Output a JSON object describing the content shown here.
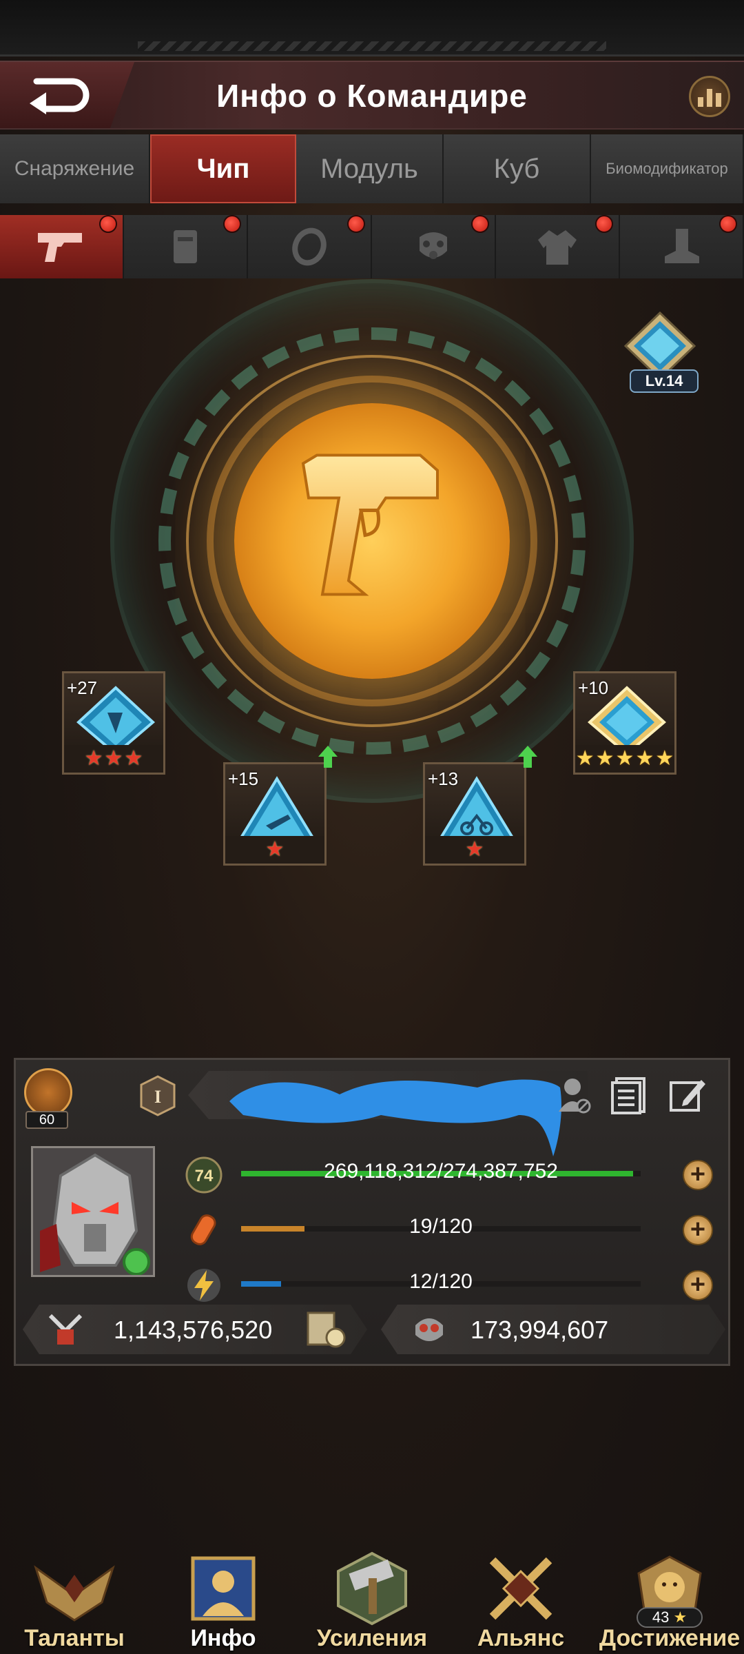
{
  "header": {
    "title": "Инфо о Командире"
  },
  "tabs": [
    {
      "label": "Снаряжение"
    },
    {
      "label": "Чип"
    },
    {
      "label": "Модуль"
    },
    {
      "label": "Куб"
    },
    {
      "label": "Биомодификатор"
    }
  ],
  "active_tab": "Чип",
  "slots": [
    "pistol-icon",
    "vest-icon",
    "ring-icon",
    "gas-mask-icon",
    "jacket-icon",
    "boot-icon"
  ],
  "level_badge": {
    "label": "Lv.14"
  },
  "chips": [
    {
      "plus": "+27",
      "stars": 3,
      "star_color": "red"
    },
    {
      "plus": "+15",
      "stars": 1,
      "star_color": "red",
      "upgrade": true
    },
    {
      "plus": "+13",
      "stars": 1,
      "star_color": "red",
      "upgrade": true
    },
    {
      "plus": "+10",
      "stars": 5,
      "star_color": "gold"
    }
  ],
  "commander": {
    "power_level": "60",
    "rank": "I",
    "level": "74",
    "exp_text": "269,118,312/274,387,752",
    "exp_progress": 0.981,
    "stamina_text": "19/120",
    "stamina_progress": 0.158,
    "energy_text": "12/120",
    "energy_progress": 0.1,
    "power_value": "1,143,576,520",
    "kills_value": "173,994,607"
  },
  "bottom_nav": [
    {
      "label": "Таланты"
    },
    {
      "label": "Инфо"
    },
    {
      "label": "Усиления"
    },
    {
      "label": "Альянс"
    },
    {
      "label": "Достижение",
      "count": "43"
    }
  ],
  "colors": {
    "accent_red": "#9a2c24",
    "exp_green": "#2fb52f",
    "stamina_orange": "#c8842a",
    "energy_blue": "#1f7ac8",
    "gold": "#f3a52a"
  }
}
